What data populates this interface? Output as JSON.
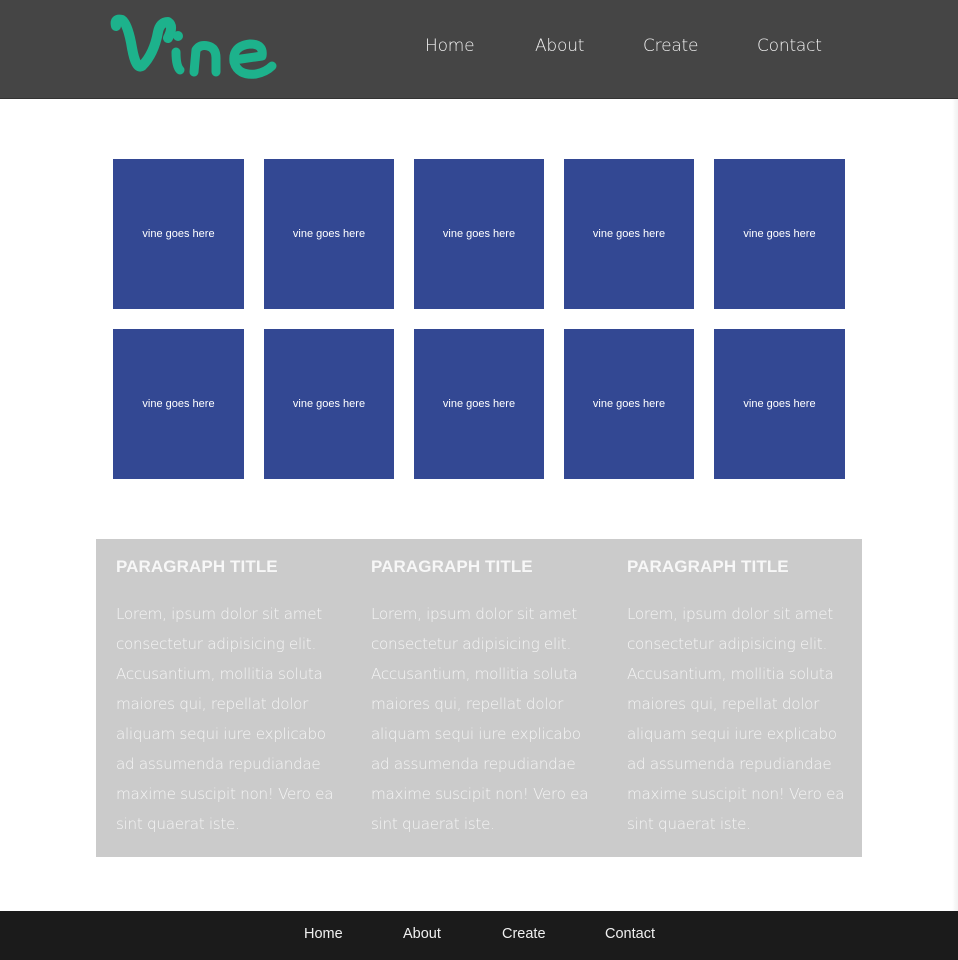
{
  "brand": {
    "logo_text": "Vine",
    "logo_color": "#1db28c"
  },
  "nav": {
    "items": [
      {
        "label": "Home"
      },
      {
        "label": "About"
      },
      {
        "label": "Create"
      },
      {
        "label": "Contact"
      }
    ]
  },
  "tiles": {
    "placeholder": "vine goes here",
    "color": "#334893",
    "count": 10
  },
  "info": {
    "columns": [
      {
        "title": "PARAGRAPH TITLE",
        "lines": [
          "Lorem, ipsum dolor sit amet",
          "consectetur adipisicing elit.",
          "Accusantium, mollitia soluta",
          "maiores qui, repellat dolor",
          "aliquam sequi iure explicabo",
          "ad assumenda repudiandae",
          "maxime suscipit non! Vero ea",
          "sint quaerat iste."
        ]
      },
      {
        "title": "PARAGRAPH TITLE",
        "lines": [
          "Lorem, ipsum dolor sit amet",
          "consectetur adipisicing elit.",
          "Accusantium, mollitia soluta",
          "maiores qui, repellat dolor",
          "aliquam sequi iure explicabo",
          "ad assumenda repudiandae",
          "maxime suscipit non! Vero ea",
          "sint quaerat iste."
        ]
      },
      {
        "title": "PARAGRAPH TITLE",
        "lines": [
          "Lorem, ipsum dolor sit amet",
          "consectetur adipisicing elit.",
          "Accusantium, mollitia soluta",
          "maiores qui, repellat dolor",
          "aliquam sequi iure explicabo",
          "ad assumenda repudiandae",
          "maxime suscipit non! Vero ea",
          "sint quaerat iste."
        ]
      }
    ]
  },
  "footer": {
    "items": [
      {
        "label": "Home"
      },
      {
        "label": "About"
      },
      {
        "label": "Create"
      },
      {
        "label": "Contact"
      }
    ]
  }
}
